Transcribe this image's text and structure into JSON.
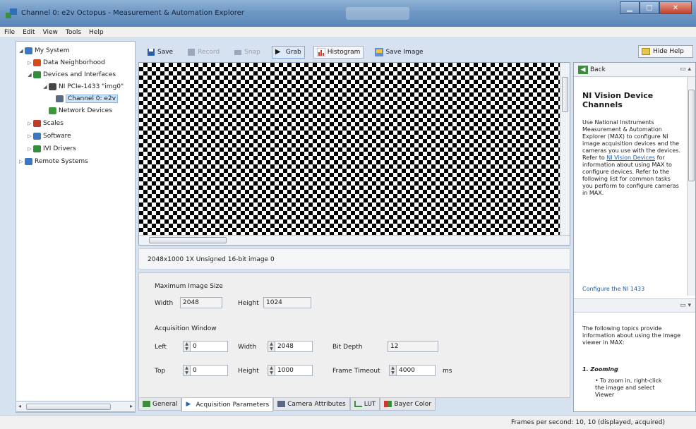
{
  "window": {
    "title": "Channel 0: e2v Octopus - Measurement & Automation Explorer"
  },
  "menu": [
    "File",
    "Edit",
    "View",
    "Tools",
    "Help"
  ],
  "tree": [
    {
      "label": "My System",
      "icon": "computer-icon",
      "color": "#3a78c2"
    },
    {
      "label": "Data Neighborhood",
      "icon": "data-icon",
      "color": "#d84a1b"
    },
    {
      "label": "Devices and Interfaces",
      "icon": "devices-icon",
      "color": "#2f8f3a"
    },
    {
      "label": "NI PCIe-1433 \"img0\"",
      "icon": "board-icon",
      "color": "#444444"
    },
    {
      "label": "Channel 0: e2v",
      "icon": "channel-icon",
      "color": "#5a6a86"
    },
    {
      "label": "Network Devices",
      "icon": "network-icon",
      "color": "#3a9a3a"
    },
    {
      "label": "Scales",
      "icon": "scales-icon",
      "color": "#c23a2a"
    },
    {
      "label": "Software",
      "icon": "software-icon",
      "color": "#3a78c2"
    },
    {
      "label": "IVI Drivers",
      "icon": "drivers-icon",
      "color": "#2f8f3a"
    },
    {
      "label": "Remote Systems",
      "icon": "remote-icon",
      "color": "#3a78c2"
    }
  ],
  "toolbar": {
    "save": "Save",
    "record": "Record",
    "snap": "Snap",
    "grab": "Grab",
    "histogram": "Histogram",
    "save_image": "Save Image",
    "hide_help": "Hide Help"
  },
  "image_info": "2048x1000  1X  Unsigned 16-bit image  0",
  "settings": {
    "max_size_title": "Maximum Image Size",
    "width_label": "Width",
    "width_value": "2048",
    "height_label": "Height",
    "height_value": "1024",
    "acq_title": "Acquisition Window",
    "left_label": "Left",
    "left_value": "0",
    "aw_width_label": "Width",
    "aw_width_value": "2048",
    "bit_depth_label": "Bit Depth",
    "bit_depth_value": "12",
    "top_label": "Top",
    "top_value": "0",
    "aw_height_label": "Height",
    "aw_height_value": "1000",
    "frame_timeout_label": "Frame Timeout",
    "frame_timeout_value": "4000",
    "ms": "ms"
  },
  "tabs": [
    "General",
    "Acquisition Parameters",
    "Camera Attributes",
    "LUT",
    "Bayer Color"
  ],
  "help": {
    "back": "Back",
    "title": "NI Vision Device Channels",
    "body_pre": "Use National Instruments Measurement & Automation Explorer (MAX) to configure NI image acquisition devices and the cameras you use with the devices. Refer to ",
    "body_link": "NI Vision Devices",
    "body_post": " for information about using MAX to configure devices. Refer to the following list for common tasks you perform to configure cameras in MAX.",
    "section_link": "Configure the NI 1433",
    "body2": "The following topics provide information about using the image viewer in MAX:",
    "li1": "1.  Zooming",
    "li2": "To zoom in, right-click the image and select Viewer"
  },
  "status": "Frames per second: 10, 10 (displayed, acquired)"
}
